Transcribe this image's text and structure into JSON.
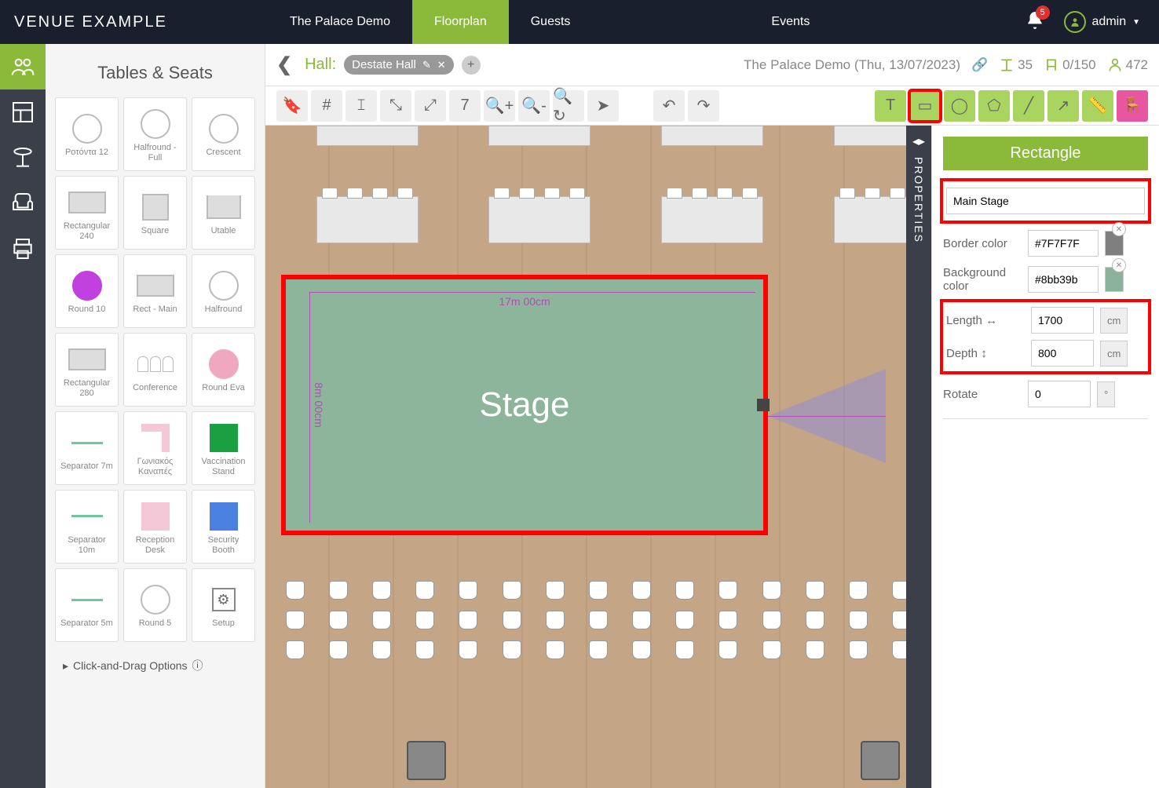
{
  "app": {
    "logo": "VENUE EXAMPLE"
  },
  "nav": {
    "items": [
      "The Palace Demo",
      "Floorplan",
      "Guests"
    ],
    "events": "Events",
    "badge": "5",
    "user": "admin"
  },
  "subheader": {
    "hall_label": "Hall:",
    "hall_name": "Destate Hall",
    "event_text": "The Palace Demo (Thu, 13/07/2023)",
    "stat_tables": "35",
    "stat_seats": "0/150",
    "stat_guests": "472"
  },
  "tables_panel": {
    "title": "Tables & Seats",
    "items": [
      "Ροτόντα 12",
      "Halfround - Full",
      "Crescent",
      "Rectangular 240",
      "Square",
      "Utable",
      "Round 10",
      "Rect - Main",
      "Halfround",
      "Rectangular 280",
      "Conference",
      "Round Eva",
      "Separator 7m",
      "Γωνιακός Καναπές",
      "Vaccination Stand",
      "Separator 10m",
      "Reception Desk",
      "Security Booth",
      "Separator 5m",
      "Round 5",
      "Setup"
    ],
    "click_drag": "Click-and-Drag Options"
  },
  "canvas": {
    "stage_text": "Stage",
    "dim_h": "17m 00cm",
    "dim_v": "8m 00cm"
  },
  "properties": {
    "rail_label": "PROPERTIES",
    "title": "Rectangle",
    "name_value": "Main Stage",
    "border_label": "Border color",
    "border_value": "#7F7F7F",
    "bg_label": "Background color",
    "bg_value": "#8bb39b",
    "length_label": "Length",
    "length_value": "1700",
    "depth_label": "Depth",
    "depth_value": "800",
    "unit": "cm",
    "rotate_label": "Rotate",
    "rotate_value": "0",
    "deg": "°"
  }
}
